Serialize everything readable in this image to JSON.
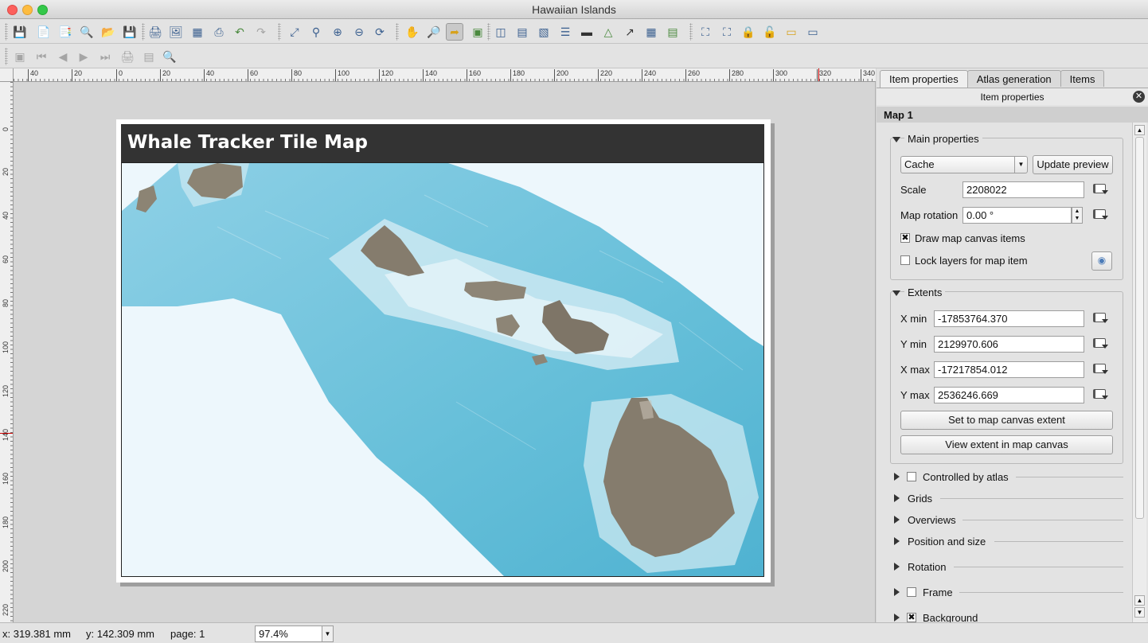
{
  "window": {
    "title": "Hawaiian Islands"
  },
  "toolbar1": {
    "icons": [
      "save-icon",
      "new-composer-icon",
      "duplicate-composer-icon",
      "composer-manager-icon",
      "open-template-icon",
      "save-template-icon",
      "print-icon",
      "export-image-icon",
      "export-svg-icon",
      "export-pdf-icon",
      "undo-icon",
      "redo-icon",
      "zoom-full-icon",
      "zoom-actual-icon",
      "zoom-in-icon",
      "zoom-out-icon",
      "refresh-icon",
      "pan-icon",
      "zoom-tool-icon",
      "select-move-icon",
      "move-content-icon",
      "add-map-icon",
      "add-image-icon",
      "add-label-icon",
      "add-legend-icon",
      "add-scalebar-icon",
      "add-shape-icon",
      "add-arrow-icon",
      "add-table-icon",
      "add-html-icon",
      "group-icon",
      "ungroup-icon",
      "lock-icon",
      "unlock-icon",
      "raise-items-icon",
      "align-items-icon"
    ]
  },
  "toolbar2": {
    "icons": [
      "atlas-preview-icon",
      "first-feature-icon",
      "previous-feature-icon",
      "next-feature-icon",
      "last-feature-icon",
      "print-atlas-icon",
      "export-atlas-icon",
      "atlas-settings-icon"
    ]
  },
  "ruler": {
    "h_labels": [
      "40",
      "20",
      "0",
      "20",
      "40",
      "60",
      "80",
      "100",
      "120",
      "140",
      "160",
      "180",
      "200",
      "220",
      "240",
      "260",
      "280",
      "300",
      "320",
      "340"
    ],
    "v_labels": [
      "0",
      "20",
      "40",
      "60",
      "80",
      "100",
      "120",
      "140",
      "160",
      "180",
      "200",
      "220"
    ]
  },
  "composition": {
    "title": "Whale Tracker Tile Map"
  },
  "dock": {
    "tabs": [
      "Item properties",
      "Atlas generation",
      "Items"
    ],
    "header": "Item properties",
    "close_glyph": "✕",
    "item_name": "Map 1",
    "main_props": {
      "title": "Main properties",
      "mode": "Cache",
      "update_preview": "Update preview",
      "scale_label": "Scale",
      "scale_value": "2208022",
      "rotation_label": "Map rotation",
      "rotation_value": "0.00 °",
      "draw_canvas_items": "Draw map canvas items",
      "draw_canvas_items_checked": true,
      "lock_layers": "Lock layers for map item",
      "lock_layers_checked": false
    },
    "extents": {
      "title": "Extents",
      "xmin_label": "X min",
      "xmin": "-17853764.370",
      "ymin_label": "Y min",
      "ymin": "2129970.606",
      "xmax_label": "X max",
      "xmax": "-17217854.012",
      "ymax_label": "Y max",
      "ymax": "2536246.669",
      "set_extent": "Set to map canvas extent",
      "view_extent": "View extent in map canvas"
    },
    "collapsed_sections": [
      "Controlled by atlas",
      "Grids",
      "Overviews",
      "Position and size",
      "Rotation",
      "Frame",
      "Background"
    ]
  },
  "statusbar": {
    "x": "x: 319.381 mm",
    "y": "y: 142.309 mm",
    "page": "page: 1",
    "zoom": "97.4%"
  },
  "colors": {
    "ocean_deep": "#5fbcd8",
    "ocean_shelf": "#cfeaf3",
    "land": "#8c8474",
    "title_bg": "#333333"
  }
}
